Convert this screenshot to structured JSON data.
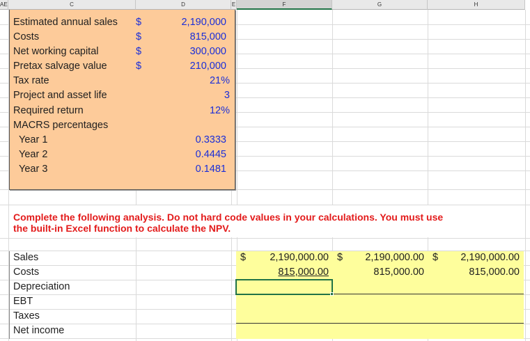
{
  "columns": [
    "AE",
    "C",
    "D",
    "E",
    "F",
    "G",
    "H"
  ],
  "inputs": {
    "rows": [
      {
        "label": "Estimated annual sales",
        "currency": "$",
        "value": "2,190,000"
      },
      {
        "label": "Costs",
        "currency": "$",
        "value": "815,000"
      },
      {
        "label": "Net working capital",
        "currency": "$",
        "value": "300,000"
      },
      {
        "label": "Pretax salvage value",
        "currency": "$",
        "value": "210,000"
      },
      {
        "label": "Tax rate",
        "currency": "",
        "value": "21%"
      },
      {
        "label": "Project and asset life",
        "currency": "",
        "value": "3"
      },
      {
        "label": "Required return",
        "currency": "",
        "value": "12%"
      },
      {
        "label": "MACRS  percentages",
        "currency": "",
        "value": ""
      },
      {
        "label": "Year 1",
        "currency": "",
        "value": "0.3333"
      },
      {
        "label": "Year 2",
        "currency": "",
        "value": "0.4445"
      },
      {
        "label": "Year 3",
        "currency": "",
        "value": "0.1481"
      }
    ]
  },
  "instruction": {
    "line1": "Complete the following analysis. Do not hard code values in your calculations. You must use",
    "line2": "the built-in Excel function to calculate the NPV."
  },
  "analysis": {
    "labels": [
      "Sales",
      "Costs",
      "Depreciation",
      "EBT",
      "Taxes",
      "Net income"
    ],
    "sales": {
      "currency": "$",
      "values": [
        "2,190,000.00",
        "2,190,000.00",
        "2,190,000.00"
      ]
    },
    "costs": {
      "values": [
        "815,000.00",
        "815,000.00",
        "815,000.00"
      ]
    }
  },
  "colors": {
    "input_fill": "#fdcb9a",
    "output_fill": "#fefe9c",
    "instruction_text": "#e31b1b",
    "value_text": "#1a2ed8"
  }
}
